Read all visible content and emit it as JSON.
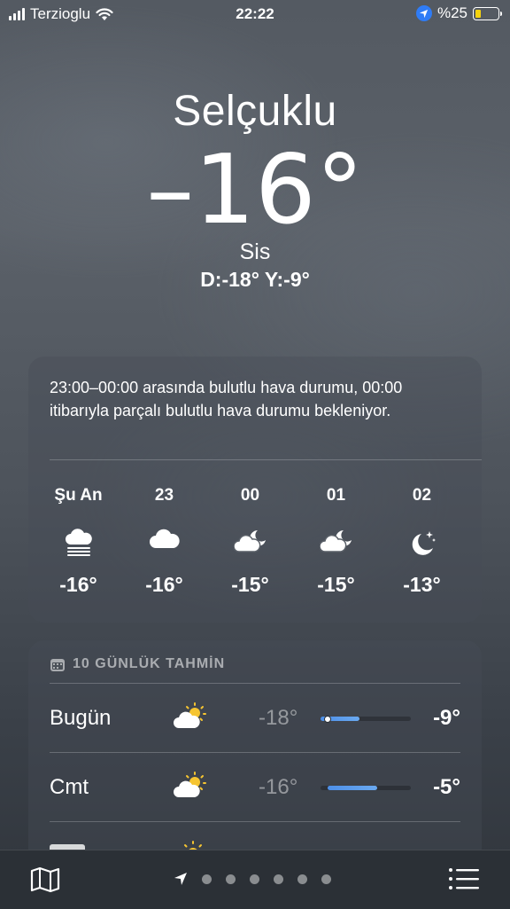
{
  "status_bar": {
    "carrier": "Terzioglu",
    "time": "22:22",
    "battery": "%25",
    "battery_level": 0.25
  },
  "location": {
    "city": "Selçuklu"
  },
  "current": {
    "temperature": "–16°",
    "condition": "Sis",
    "low_high": "D:-18°  Y:-9°"
  },
  "hourly": {
    "summary": "23:00–00:00 arasında bulutlu hava durumu, 00:00 itibarıyla parçalı bulutlu hava durumu bekleniyor.",
    "items": [
      {
        "label": "Şu An",
        "icon": "fog-icon",
        "temp": "-16°"
      },
      {
        "label": "23",
        "icon": "cloud-icon",
        "temp": "-16°"
      },
      {
        "label": "00",
        "icon": "cloud-moon-icon",
        "temp": "-15°"
      },
      {
        "label": "01",
        "icon": "cloud-moon-icon",
        "temp": "-15°"
      },
      {
        "label": "02",
        "icon": "moon-stars-icon",
        "temp": "-13°"
      }
    ]
  },
  "forecast": {
    "title": "10 GÜNLÜK TAHMİN",
    "days": [
      {
        "day": "Bugün",
        "icon": "sun-cloud-icon",
        "low": "-18°",
        "high": "-9°",
        "range_start": 0.0,
        "range_end": 0.43,
        "current_marker": 0.08
      },
      {
        "day": "Cmt",
        "icon": "sun-cloud-icon",
        "low": "-16°",
        "high": "-5°",
        "range_start": 0.08,
        "range_end": 0.63,
        "current_marker": null
      }
    ]
  },
  "pager": {
    "pages": 6,
    "active": 0
  }
}
